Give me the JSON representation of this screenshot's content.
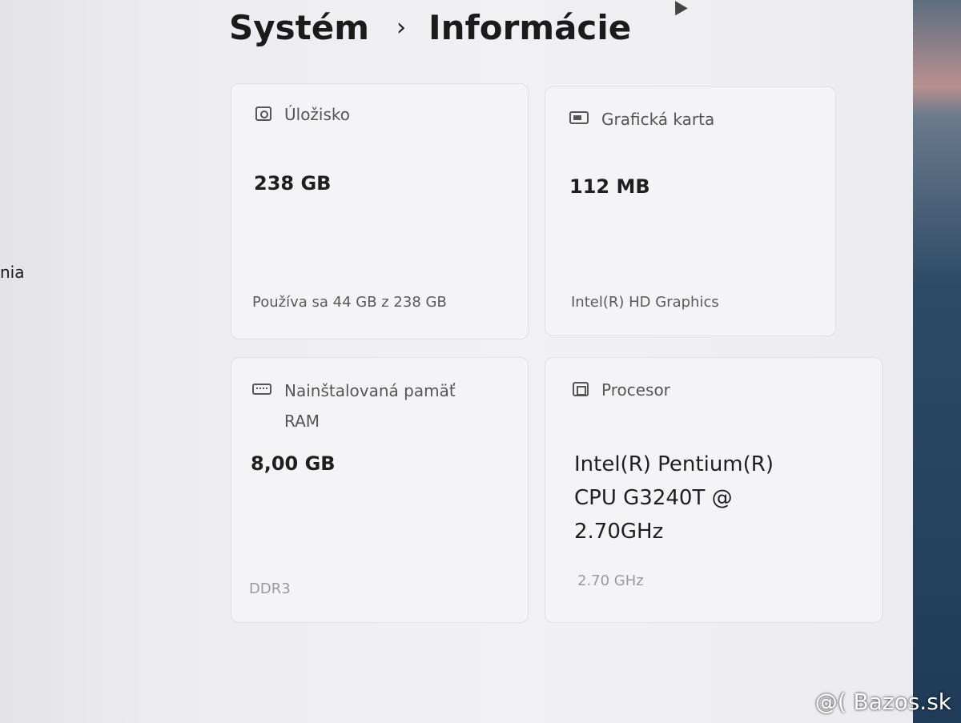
{
  "sidebar": {
    "partial_item": "nia"
  },
  "breadcrumb": {
    "parent": "Systém",
    "separator": "›",
    "current": "Informácie"
  },
  "cards": {
    "storage": {
      "label": "Úložisko",
      "value": "238 GB",
      "detail": "Používa sa 44 GB z 238 GB"
    },
    "graphics": {
      "label": "Grafická karta",
      "value": "112 MB",
      "detail": "Intel(R) HD Graphics"
    },
    "memory": {
      "label_line1": "Nainštalovaná pamäť",
      "label_line2": "RAM",
      "value": "8,00 GB",
      "detail": "DDR3"
    },
    "processor": {
      "label": "Procesor",
      "value_line1": "Intel(R) Pentium(R)",
      "value_line2": "CPU G3240T @",
      "value_line3": "2.70GHz",
      "detail": "2.70 GHz"
    }
  },
  "watermark": "@( Bazos.sk",
  "icons": [
    "disk-icon",
    "gpu-icon",
    "ram-icon",
    "cpu-icon",
    "pointer-cursor-icon"
  ]
}
